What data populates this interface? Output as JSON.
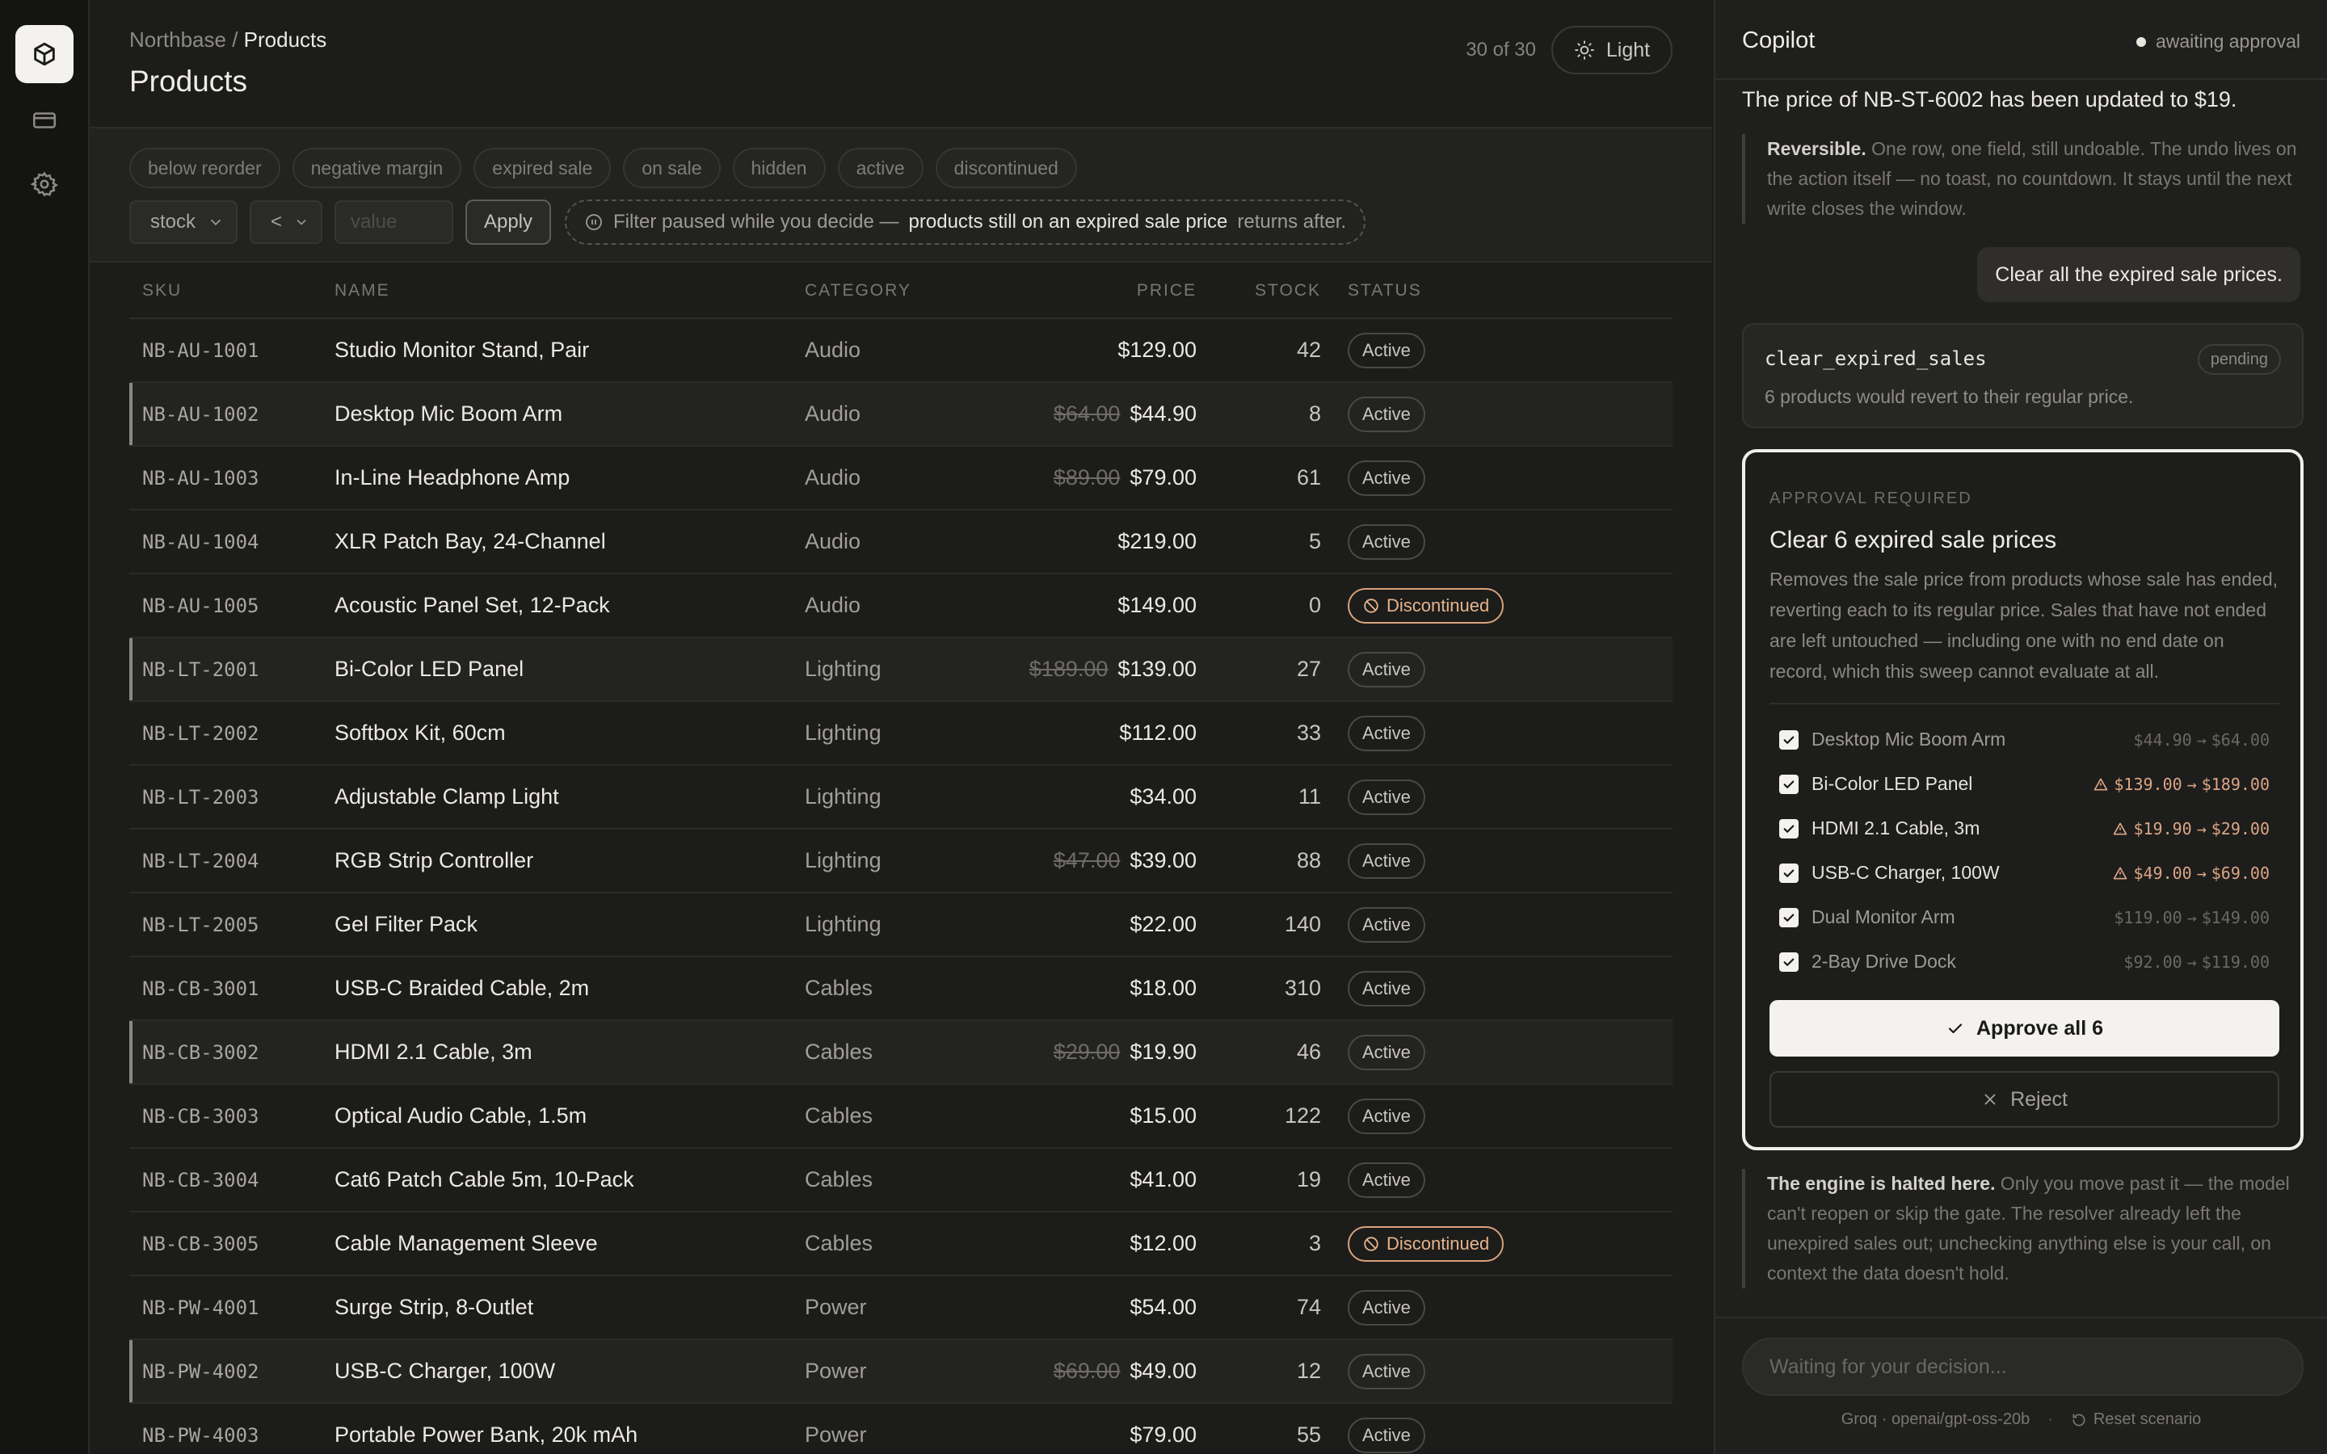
{
  "nav": {
    "items": [
      {
        "icon": "box-icon",
        "active": true
      },
      {
        "icon": "card-icon",
        "active": false
      },
      {
        "icon": "gear-icon",
        "active": false
      }
    ]
  },
  "header": {
    "breadcrumb_root": "Northbase",
    "breadcrumb_sep": "/",
    "breadcrumb_current": "Products",
    "title": "Products",
    "count": "30 of 30",
    "theme_label": "Light"
  },
  "filters": {
    "chips": [
      "below reorder",
      "negative margin",
      "expired sale",
      "on sale",
      "hidden",
      "active",
      "discontinued"
    ],
    "field_select": "stock",
    "operator_select": "<",
    "value_placeholder": "value",
    "apply_label": "Apply",
    "paused_pre": "Filter paused while you decide —",
    "paused_highlight": "products still on an expired sale price",
    "paused_post": "returns after."
  },
  "table": {
    "columns": {
      "sku": "SKU",
      "name": "NAME",
      "category": "CATEGORY",
      "price": "PRICE",
      "stock": "STOCK",
      "status": "STATUS"
    },
    "rows": [
      {
        "sku": "NB-AU-1001",
        "name": "Studio Monitor Stand, Pair",
        "category": "Audio",
        "old_price": "",
        "price": "$129.00",
        "stock": "42",
        "status": "Active",
        "sale": false
      },
      {
        "sku": "NB-AU-1002",
        "name": "Desktop Mic Boom Arm",
        "category": "Audio",
        "old_price": "$64.00",
        "price": "$44.90",
        "stock": "8",
        "status": "Active",
        "sale": true
      },
      {
        "sku": "NB-AU-1003",
        "name": "In-Line Headphone Amp",
        "category": "Audio",
        "old_price": "$89.00",
        "price": "$79.00",
        "stock": "61",
        "status": "Active",
        "sale": false
      },
      {
        "sku": "NB-AU-1004",
        "name": "XLR Patch Bay, 24-Channel",
        "category": "Audio",
        "old_price": "",
        "price": "$219.00",
        "stock": "5",
        "status": "Active",
        "sale": false
      },
      {
        "sku": "NB-AU-1005",
        "name": "Acoustic Panel Set, 12-Pack",
        "category": "Audio",
        "old_price": "",
        "price": "$149.00",
        "stock": "0",
        "status": "Discontinued",
        "sale": false
      },
      {
        "sku": "NB-LT-2001",
        "name": "Bi-Color LED Panel",
        "category": "Lighting",
        "old_price": "$189.00",
        "price": "$139.00",
        "stock": "27",
        "status": "Active",
        "sale": true
      },
      {
        "sku": "NB-LT-2002",
        "name": "Softbox Kit, 60cm",
        "category": "Lighting",
        "old_price": "",
        "price": "$112.00",
        "stock": "33",
        "status": "Active",
        "sale": false
      },
      {
        "sku": "NB-LT-2003",
        "name": "Adjustable Clamp Light",
        "category": "Lighting",
        "old_price": "",
        "price": "$34.00",
        "stock": "11",
        "status": "Active",
        "sale": false
      },
      {
        "sku": "NB-LT-2004",
        "name": "RGB Strip Controller",
        "category": "Lighting",
        "old_price": "$47.00",
        "price": "$39.00",
        "stock": "88",
        "status": "Active",
        "sale": false
      },
      {
        "sku": "NB-LT-2005",
        "name": "Gel Filter Pack",
        "category": "Lighting",
        "old_price": "",
        "price": "$22.00",
        "stock": "140",
        "status": "Active",
        "sale": false
      },
      {
        "sku": "NB-CB-3001",
        "name": "USB-C Braided Cable, 2m",
        "category": "Cables",
        "old_price": "",
        "price": "$18.00",
        "stock": "310",
        "status": "Active",
        "sale": false
      },
      {
        "sku": "NB-CB-3002",
        "name": "HDMI 2.1 Cable, 3m",
        "category": "Cables",
        "old_price": "$29.00",
        "price": "$19.90",
        "stock": "46",
        "status": "Active",
        "sale": true
      },
      {
        "sku": "NB-CB-3003",
        "name": "Optical Audio Cable, 1.5m",
        "category": "Cables",
        "old_price": "",
        "price": "$15.00",
        "stock": "122",
        "status": "Active",
        "sale": false
      },
      {
        "sku": "NB-CB-3004",
        "name": "Cat6 Patch Cable 5m, 10-Pack",
        "category": "Cables",
        "old_price": "",
        "price": "$41.00",
        "stock": "19",
        "status": "Active",
        "sale": false
      },
      {
        "sku": "NB-CB-3005",
        "name": "Cable Management Sleeve",
        "category": "Cables",
        "old_price": "",
        "price": "$12.00",
        "stock": "3",
        "status": "Discontinued",
        "sale": false
      },
      {
        "sku": "NB-PW-4001",
        "name": "Surge Strip, 8-Outlet",
        "category": "Power",
        "old_price": "",
        "price": "$54.00",
        "stock": "74",
        "status": "Active",
        "sale": false
      },
      {
        "sku": "NB-PW-4002",
        "name": "USB-C Charger, 100W",
        "category": "Power",
        "old_price": "$69.00",
        "price": "$49.00",
        "stock": "12",
        "status": "Active",
        "sale": true
      },
      {
        "sku": "NB-PW-4003",
        "name": "Portable Power Bank, 20k mAh",
        "category": "Power",
        "old_price": "",
        "price": "$79.00",
        "stock": "55",
        "status": "Active",
        "sale": false
      }
    ]
  },
  "copilot": {
    "title": "Copilot",
    "status": "awaiting approval",
    "message_top": "The price of NB-ST-6002 has been updated to $19.",
    "note1_bold": "Reversible.",
    "note1_text": "One row, one field, still undoable. The undo lives on the action itself — no toast, no countdown. It stays until the next write closes the window.",
    "user_message": "Clear all the expired sale prices.",
    "tool": {
      "name": "clear_expired_sales",
      "state": "pending",
      "desc": "6 products would revert to their regular price."
    },
    "approval": {
      "eyebrow": "APPROVAL REQUIRED",
      "title": "Clear 6 expired sale prices",
      "desc": "Removes the sale price from products whose sale has ended, reverting each to its regular price. Sales that have not ended are left untouched — including one with no end date on record, which this sweep cannot evaluate at all.",
      "items": [
        {
          "name": "Desktop Mic Boom Arm",
          "from": "$44.90",
          "to": "$64.00",
          "warn": false,
          "checked": true
        },
        {
          "name": "Bi-Color LED Panel",
          "from": "$139.00",
          "to": "$189.00",
          "warn": true,
          "checked": true
        },
        {
          "name": "HDMI 2.1 Cable, 3m",
          "from": "$19.90",
          "to": "$29.00",
          "warn": true,
          "checked": true
        },
        {
          "name": "USB-C Charger, 100W",
          "from": "$49.00",
          "to": "$69.00",
          "warn": true,
          "checked": true
        },
        {
          "name": "Dual Monitor Arm",
          "from": "$119.00",
          "to": "$149.00",
          "warn": false,
          "checked": true
        },
        {
          "name": "2-Bay Drive Dock",
          "from": "$92.00",
          "to": "$119.00",
          "warn": false,
          "checked": true
        }
      ],
      "approve_label": "Approve all 6",
      "reject_label": "Reject"
    },
    "note2_bold": "The engine is halted here.",
    "note2_text": "Only you move past it — the model can't reopen or skip the gate. The resolver already left the unexpired sales out; unchecking anything else is your call, on context the data doesn't hold.",
    "composer_placeholder": "Waiting for your decision...",
    "footer_model": "Groq · openai/gpt-oss-20b",
    "footer_sep": "·",
    "footer_reset": "Reset scenario"
  },
  "colors": {
    "accent_warn": "#dca583",
    "discontinued": "#e6b38c",
    "approval_border": "#f1efea"
  }
}
